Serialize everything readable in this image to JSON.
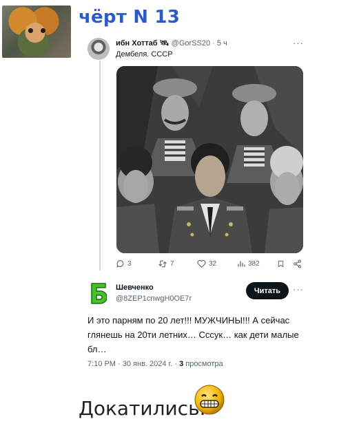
{
  "header": {
    "title": "чёрт N 13"
  },
  "tweet_parent": {
    "display_name": "ибн Хоттаб 🛰",
    "handle": "@GorSS20",
    "time": "· 5 ч",
    "text": "Дембеля. СССР",
    "more": "···",
    "stats": {
      "replies": "3",
      "retweets": "7",
      "likes": "32",
      "views": "382"
    }
  },
  "tweet_reply": {
    "display_name": "Шевченко",
    "handle": "@8ZEP1cnwgH0OE7r",
    "read_button": "Читать",
    "more": "···",
    "text": "И  это парням по 20 лет!!!  МУЖЧИНЫ!!!  А сейчас глянешь на 20ти летних…  Сссук…   как дети малые бл…",
    "meta_date": "7:10 PM · 30 янв. 2024 г. · ",
    "meta_views_count": "3",
    "meta_views_label": " просмотра"
  },
  "footer": {
    "text": "Докатились."
  },
  "colors": {
    "title_blue": "#2d5bc6",
    "button_bg": "#0f1419",
    "muted": "#536471",
    "avatar_green": "#48c22a"
  }
}
